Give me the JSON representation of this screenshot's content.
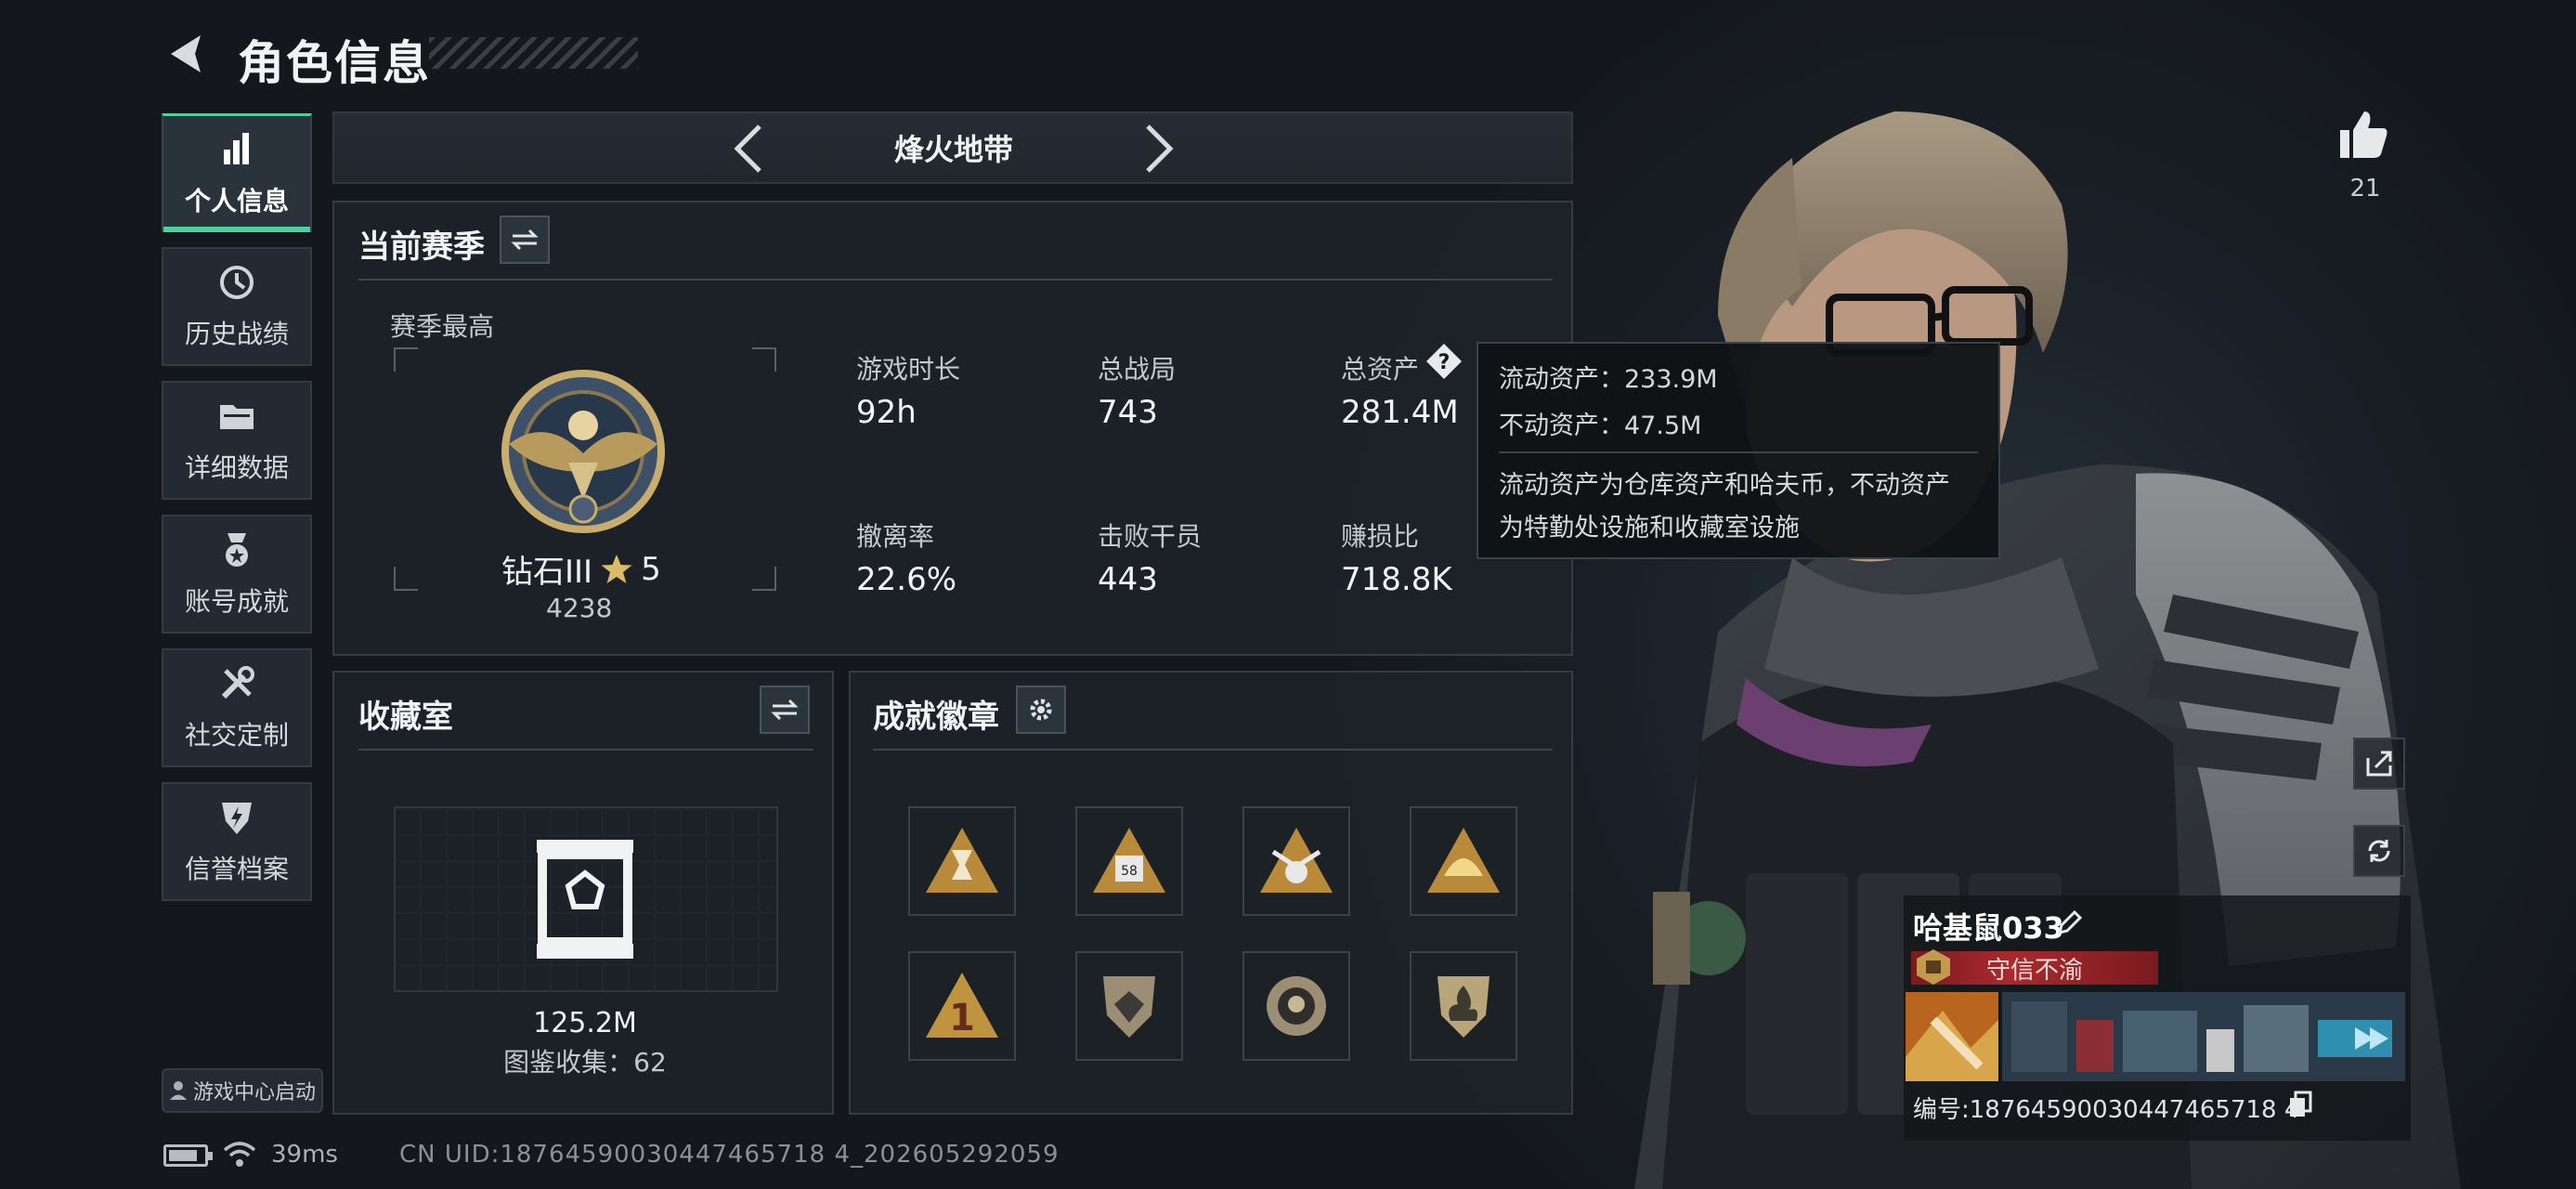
{
  "header": {
    "title": "角色信息"
  },
  "nav": {
    "items": [
      {
        "label": "个人信息",
        "icon": "bar-chart-icon",
        "active": true
      },
      {
        "label": "历史战绩",
        "icon": "history-icon",
        "active": false
      },
      {
        "label": "详细数据",
        "icon": "folder-icon",
        "active": false
      },
      {
        "label": "账号成就",
        "icon": "achievement-icon",
        "active": false
      },
      {
        "label": "社交定制",
        "icon": "tools-icon",
        "active": false
      },
      {
        "label": "信誉档案",
        "icon": "credit-icon",
        "active": false
      }
    ],
    "game_center_label": "游戏中心启动"
  },
  "status_bar": {
    "ping": "39ms",
    "uid": "CN UID:18764590030447465718 4_202605292059"
  },
  "mode": {
    "name": "烽火地带"
  },
  "season": {
    "title": "当前赛季",
    "best_label": "赛季最高",
    "rank_name": "钻石III",
    "rank_stars": "5",
    "rank_score": "4238",
    "stats": [
      {
        "label": "游戏时长",
        "value": "92h"
      },
      {
        "label": "总战局",
        "value": "743"
      },
      {
        "label": "总资产",
        "value": "281.4M"
      },
      {
        "label": "撤离率",
        "value": "22.6%"
      },
      {
        "label": "击败干员",
        "value": "443"
      },
      {
        "label": "赚损比",
        "value": "718.8K"
      }
    ]
  },
  "tooltip": {
    "liquid": "流动资产：233.9M",
    "fixed": "不动资产：47.5M",
    "desc_line1": "流动资产为仓库资产和哈夫币，不动资产",
    "desc_line2": "为特勤处设施和收藏室设施"
  },
  "collection": {
    "title": "收藏室",
    "value": "125.2M",
    "count_label": "图鉴收集：62"
  },
  "badges": {
    "title": "成就徽章",
    "items": [
      {
        "name": "badge-hourglass"
      },
      {
        "name": "badge-58-a"
      },
      {
        "name": "badge-59"
      },
      {
        "name": "badge-wave"
      },
      {
        "name": "badge-1"
      },
      {
        "name": "badge-diamond"
      },
      {
        "name": "badge-seal"
      },
      {
        "name": "badge-fire"
      }
    ]
  },
  "profile": {
    "likes": "21",
    "player_name": "哈基鼠033",
    "title": "守信不渝",
    "id_label": "编号:18764590030447465718 4"
  },
  "colors": {
    "accent": "#4fcf9b",
    "banner": "#a82a2e"
  }
}
